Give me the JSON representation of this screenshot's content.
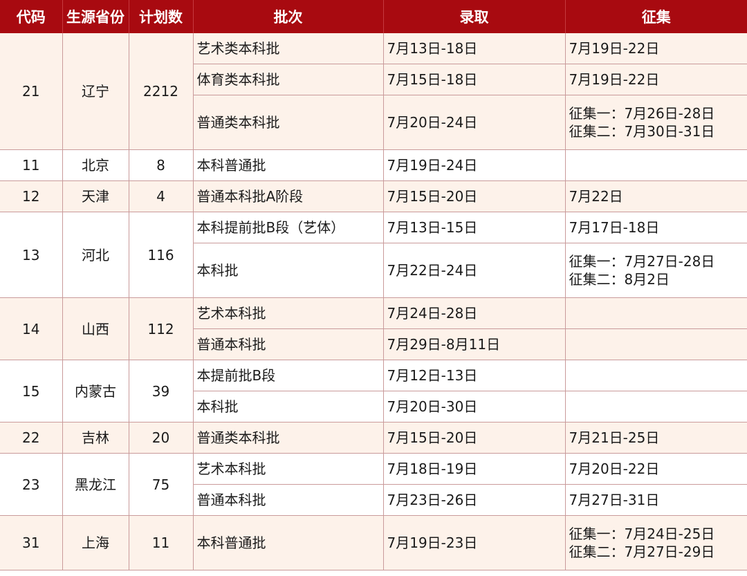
{
  "headers": {
    "code": "代码",
    "province": "生源省份",
    "plan": "计划数",
    "batch": "批次",
    "admission": "录取",
    "collection": "征集"
  },
  "groups": [
    {
      "code": "21",
      "province": "辽宁",
      "plan": "2212",
      "rows": [
        {
          "batch": "艺术类本科批",
          "admission": "7月13日-18日",
          "collection": [
            "7月19日-22日"
          ]
        },
        {
          "batch": "体育类本科批",
          "admission": "7月15日-18日",
          "collection": [
            "7月19日-22日"
          ]
        },
        {
          "batch": "普通类本科批",
          "admission": "7月20日-24日",
          "collection": [
            "征集一：7月26日-28日",
            "征集二：7月30日-31日"
          ]
        }
      ]
    },
    {
      "code": "11",
      "province": "北京",
      "plan": "8",
      "rows": [
        {
          "batch": "本科普通批",
          "admission": "7月19日-24日",
          "collection": []
        }
      ]
    },
    {
      "code": "12",
      "province": "天津",
      "plan": "4",
      "rows": [
        {
          "batch": "普通本科批A阶段",
          "admission": "7月15日-20日",
          "collection": [
            "7月22日"
          ]
        }
      ]
    },
    {
      "code": "13",
      "province": "河北",
      "plan": "116",
      "rows": [
        {
          "batch": "本科提前批B段（艺体）",
          "admission": "7月13日-15日",
          "collection": [
            "7月17日-18日"
          ]
        },
        {
          "batch": "本科批",
          "admission": "7月22日-24日",
          "collection": [
            "征集一：7月27日-28日",
            "征集二：8月2日"
          ]
        }
      ]
    },
    {
      "code": "14",
      "province": "山西",
      "plan": "112",
      "rows": [
        {
          "batch": "艺术本科批",
          "admission": "7月24日-28日",
          "collection": []
        },
        {
          "batch": "普通本科批",
          "admission": "7月29日-8月11日",
          "collection": []
        }
      ]
    },
    {
      "code": "15",
      "province": "内蒙古",
      "plan": "39",
      "rows": [
        {
          "batch": "本提前批B段",
          "admission": "7月12日-13日",
          "collection": []
        },
        {
          "batch": "本科批",
          "admission": "7月20日-30日",
          "collection": []
        }
      ]
    },
    {
      "code": "22",
      "province": "吉林",
      "plan": "20",
      "rows": [
        {
          "batch": "普通类本科批",
          "admission": "7月15日-20日",
          "collection": [
            "7月21日-25日"
          ]
        }
      ]
    },
    {
      "code": "23",
      "province": "黑龙江",
      "plan": "75",
      "rows": [
        {
          "batch": "艺术本科批",
          "admission": "7月18日-19日",
          "collection": [
            "7月20日-22日"
          ]
        },
        {
          "batch": "普通本科批",
          "admission": "7月23日-26日",
          "collection": [
            "7月27日-31日"
          ]
        }
      ]
    },
    {
      "code": "31",
      "province": "上海",
      "plan": "11",
      "rows": [
        {
          "batch": "本科普通批",
          "admission": "7月19日-23日",
          "collection": [
            "征集一：7月24日-25日",
            "征集二：7月27日-29日"
          ]
        }
      ]
    }
  ],
  "colors": {
    "header_bg": "#a80a10",
    "header_text": "#ffffff",
    "row_alt_bg": "#fdf2ea",
    "row_bg": "#ffffff",
    "border": "#c99a9a"
  }
}
